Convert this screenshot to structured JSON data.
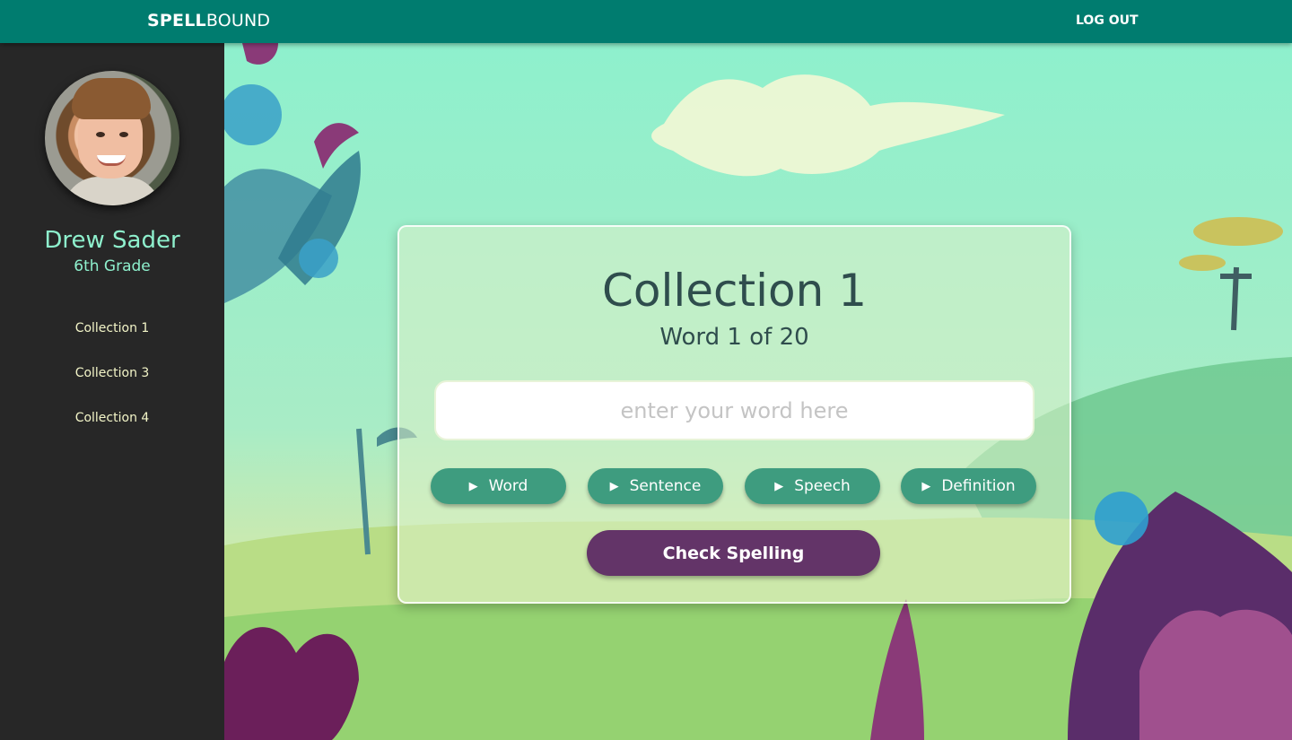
{
  "app": {
    "logo_bold": "SPELL",
    "logo_rest": "BOUND",
    "logout": "LOG OUT"
  },
  "profile": {
    "name": "Drew Sader",
    "grade": "6th Grade"
  },
  "sidebar": {
    "items": [
      {
        "label": "Collection 1"
      },
      {
        "label": "Collection 3"
      },
      {
        "label": "Collection 4"
      }
    ]
  },
  "quiz": {
    "title": "Collection 1",
    "progress": "Word 1 of 20",
    "input_value": "",
    "input_placeholder": "enter your word here",
    "buttons": [
      {
        "label": "Word"
      },
      {
        "label": "Sentence"
      },
      {
        "label": "Speech"
      },
      {
        "label": "Definition"
      }
    ],
    "check_label": "Check Spelling"
  },
  "colors": {
    "topbar": "#007c6f",
    "sidebar": "#272727",
    "accent_mint": "#8ef0cd",
    "pill_green": "#3e9c7f",
    "check_purple": "#633468"
  },
  "icons": {
    "play": "play-triangle-icon"
  }
}
